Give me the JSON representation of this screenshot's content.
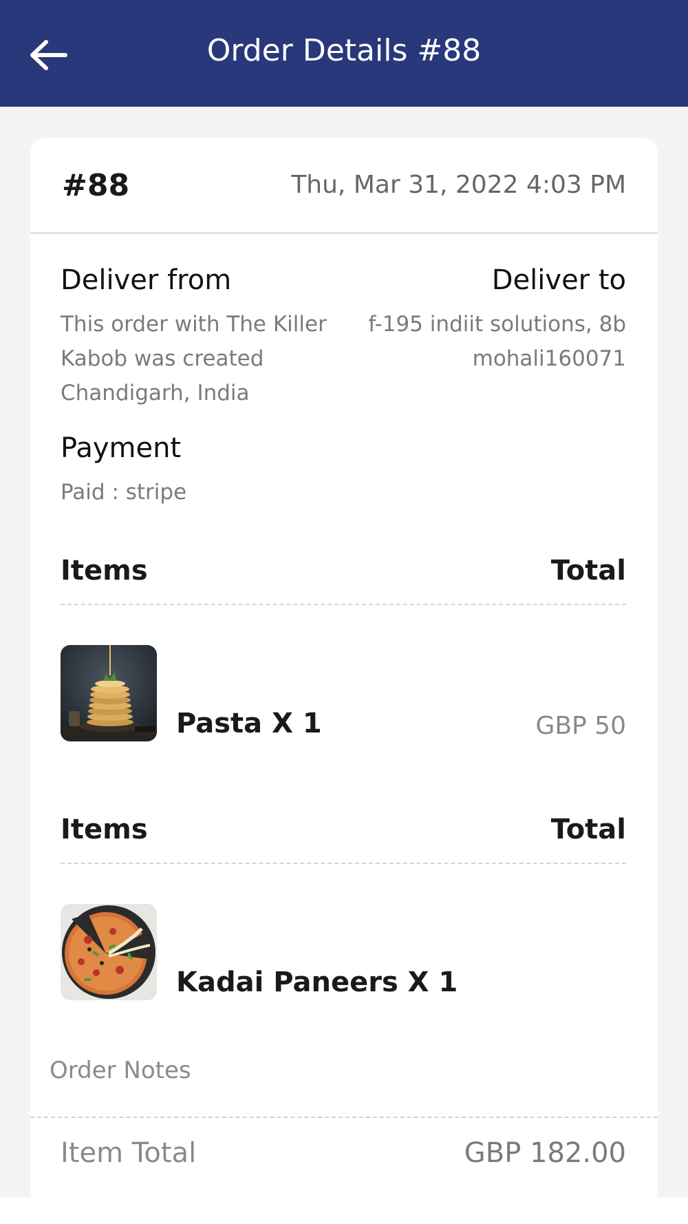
{
  "header": {
    "title": "Order Details #88",
    "back_icon": "arrow-left-icon",
    "bg_color": "#28387a"
  },
  "order": {
    "id": "#88",
    "date": "Thu, Mar 31, 2022 4:03 PM"
  },
  "deliver_from": {
    "heading": "Deliver from",
    "lines": [
      "This order with The Killer",
      "Kabob was created",
      "Chandigarh, India"
    ]
  },
  "deliver_to": {
    "heading": "Deliver to",
    "lines": [
      "f-195 indiit solutions, 8b",
      "mohali160071"
    ]
  },
  "payment": {
    "heading": "Payment",
    "text": "Paid : stripe"
  },
  "item_groups": [
    {
      "items_label": "Items",
      "total_label": "Total",
      "name": "Pasta X 1",
      "price": "GBP 50",
      "image": "pancake-stack-photo"
    },
    {
      "items_label": "Items",
      "total_label": "Total",
      "name": "Kadai Paneers X 1",
      "price": "",
      "image": "pizza-photo"
    }
  ],
  "notes": {
    "label": "Order Notes"
  },
  "summary": {
    "item_total_label": "Item Total",
    "item_total_value": "GBP 182.00"
  }
}
